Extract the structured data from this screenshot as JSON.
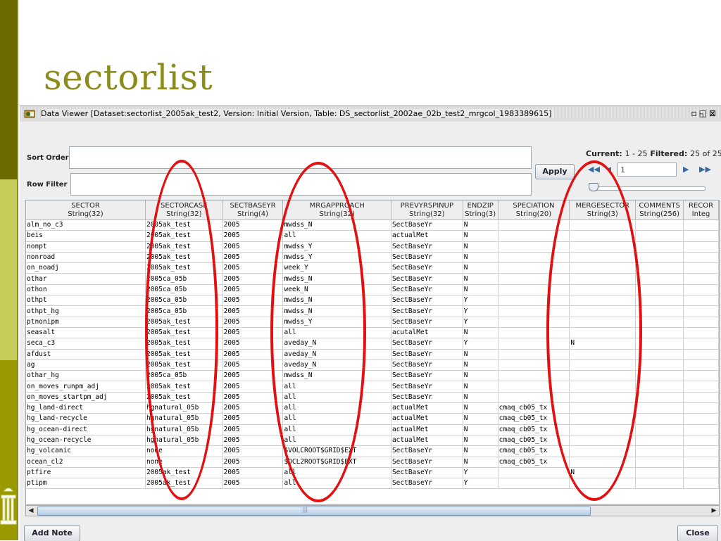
{
  "slide": {
    "title": "sectorlist"
  },
  "window": {
    "title": "Data Viewer [Dataset:sectorlist_2005ak_test2, Version: Initial Version, Table: DS_sectorlist_2002ae_02b_test2_mrgcol_1983389615]",
    "controls": [
      "minimize-icon",
      "maximize-icon",
      "close-icon"
    ]
  },
  "filters": {
    "sort_label": "Sort Order",
    "row_filter_label": "Row Filter",
    "sort_value": "",
    "row_filter_value": ""
  },
  "apply_label": "Apply",
  "paging": {
    "current_label": "Current:",
    "current_range": "1 - 25",
    "filtered_label": "Filtered:",
    "filtered_value": "25 of 25",
    "page_value": "1"
  },
  "columns": [
    {
      "name": "SECTOR",
      "type": "String(32)"
    },
    {
      "name": "SECTORCASE",
      "type": "String(32)"
    },
    {
      "name": "SECTBASEYR",
      "type": "String(4)"
    },
    {
      "name": "MRGAPPROACH",
      "type": "String(32)"
    },
    {
      "name": "PREVYRSPINUP",
      "type": "String(32)"
    },
    {
      "name": "ENDZIP",
      "type": "String(3)"
    },
    {
      "name": "SPECIATION",
      "type": "String(20)"
    },
    {
      "name": "MERGESECTOR",
      "type": "String(3)"
    },
    {
      "name": "COMMENTS",
      "type": "String(256)"
    },
    {
      "name": "RECOR",
      "type": "Integ"
    }
  ],
  "rows": [
    [
      "alm_no_c3",
      "2005ak_test",
      "2005",
      "mwdss_N",
      "SectBaseYr",
      "N",
      "",
      "",
      "",
      ""
    ],
    [
      "beis",
      "2005ak_test",
      "2005",
      "all",
      "actualMet",
      "N",
      "",
      "",
      "",
      ""
    ],
    [
      "nonpt",
      "2005ak_test",
      "2005",
      "mwdss_Y",
      "SectBaseYr",
      "N",
      "",
      "",
      "",
      ""
    ],
    [
      "nonroad",
      "2005ak_test",
      "2005",
      "mwdss_Y",
      "SectBaseYr",
      "N",
      "",
      "",
      "",
      ""
    ],
    [
      "on_noadj",
      "2005ak_test",
      "2005",
      "week_Y",
      "SectBaseYr",
      "N",
      "",
      "",
      "",
      ""
    ],
    [
      "othar",
      "2005ca_05b",
      "2005",
      "mwdss_N",
      "SectBaseYr",
      "N",
      "",
      "",
      "",
      ""
    ],
    [
      "othon",
      "2005ca_05b",
      "2005",
      "week_N",
      "SectBaseYr",
      "N",
      "",
      "",
      "",
      ""
    ],
    [
      "othpt",
      "2005ca_05b",
      "2005",
      "mwdss_N",
      "SectBaseYr",
      "Y",
      "",
      "",
      "",
      ""
    ],
    [
      "othpt_hg",
      "2005ca_05b",
      "2005",
      "mwdss_N",
      "SectBaseYr",
      "Y",
      "",
      "",
      "",
      ""
    ],
    [
      "ptnonipm",
      "2005ak_test",
      "2005",
      "mwdss_Y",
      "SectBaseYr",
      "Y",
      "",
      "",
      "",
      ""
    ],
    [
      "seasalt",
      "2005ak_test",
      "2005",
      "all",
      "acutalMet",
      "N",
      "",
      "",
      "",
      ""
    ],
    [
      "seca_c3",
      "2005ak_test",
      "2005",
      "aveday_N",
      "SectBaseYr",
      "Y",
      "",
      "N",
      "",
      ""
    ],
    [
      "afdust",
      "2005ak_test",
      "2005",
      "aveday_N",
      "SectBaseYr",
      "N",
      "",
      "",
      "",
      ""
    ],
    [
      "ag",
      "2005ak_test",
      "2005",
      "aveday_N",
      "SectBaseYr",
      "N",
      "",
      "",
      "",
      ""
    ],
    [
      "othar_hg",
      "2005ca_05b",
      "2005",
      "mwdss_N",
      "SectBaseYr",
      "N",
      "",
      "",
      "",
      ""
    ],
    [
      "on_moves_runpm_adj",
      "2005ak_test",
      "2005",
      "all",
      "SectBaseYr",
      "N",
      "",
      "",
      "",
      ""
    ],
    [
      "on_moves_startpm_adj",
      "2005ak_test",
      "2005",
      "all",
      "SectBaseYr",
      "N",
      "",
      "",
      "",
      ""
    ],
    [
      "hg_land-direct",
      "hgnatural_05b",
      "2005",
      "all",
      "actualMet",
      "N",
      "cmaq_cb05_tx",
      "",
      "",
      ""
    ],
    [
      "hg_land-recycle",
      "hgnatural_05b",
      "2005",
      "all",
      "actualMet",
      "N",
      "cmaq_cb05_tx",
      "",
      "",
      ""
    ],
    [
      "hg_ocean-direct",
      "hgnatural_05b",
      "2005",
      "all",
      "actualMet",
      "N",
      "cmaq_cb05_tx",
      "",
      "",
      ""
    ],
    [
      "hg_ocean-recycle",
      "hgnatural_05b",
      "2005",
      "all",
      "actualMet",
      "N",
      "cmaq_cb05_tx",
      "",
      "",
      ""
    ],
    [
      "hg_volcanic",
      "none",
      "2005",
      "$VOLCROOT$GRID$EXT",
      "SectBaseYr",
      "N",
      "cmaq_cb05_tx",
      "",
      "",
      ""
    ],
    [
      "ocean_cl2",
      "none",
      "2005",
      "$OCL2ROOT$GRID$EXT",
      "SectBaseYr",
      "N",
      "cmaq_cb05_tx",
      "",
      "",
      ""
    ],
    [
      "ptfire",
      "2005ak_test",
      "2005",
      "all",
      "SectBaseYr",
      "Y",
      "",
      "N",
      "",
      ""
    ],
    [
      "ptipm",
      "2005ak_test",
      "2005",
      "all",
      "SectBaseYr",
      "Y",
      "",
      "",
      "",
      ""
    ]
  ],
  "buttons": {
    "add_note": "Add Note",
    "close": "Close"
  },
  "colors": {
    "accent_olive": "#8c8c1c",
    "annotation_red": "#e21010"
  }
}
